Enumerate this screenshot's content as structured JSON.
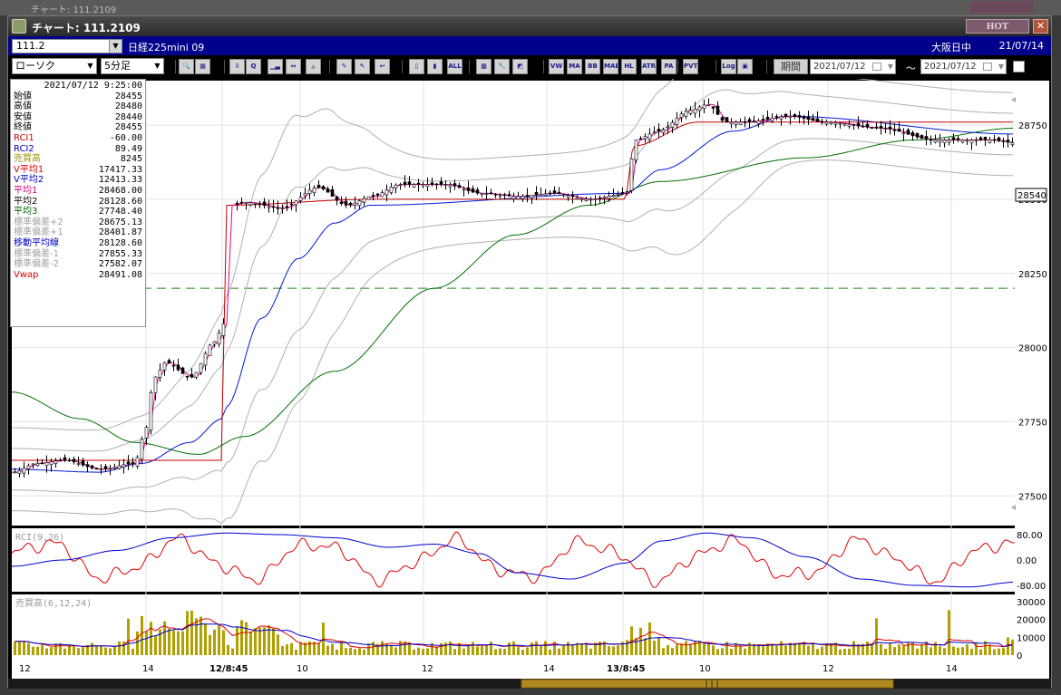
{
  "window": {
    "title": "チャート: 111.2109",
    "hot_label": "HOT",
    "close_label": "✕",
    "background_title": "チャート: 111.2109"
  },
  "infobar": {
    "symbol": "111.2",
    "name": "日経225mini 09",
    "market": "大阪日中",
    "date": "21/07/14"
  },
  "toolbar": {
    "chart_type": "ローソク",
    "interval": "5分足",
    "buttons": [
      {
        "icon": "zoom-icon",
        "label": "🔍"
      },
      {
        "icon": "layout-icon",
        "label": "▦"
      },
      {
        "icon": "download-icon",
        "label": "⇩"
      },
      {
        "icon": "search-chart-icon",
        "label": "Q"
      },
      {
        "icon": "bar-chart-icon",
        "label": "▁▃"
      },
      {
        "icon": "split-icon",
        "label": "↔"
      },
      {
        "icon": "disabled-icon",
        "label": "▲"
      },
      {
        "icon": "pencil-icon",
        "label": "✎"
      },
      {
        "icon": "cursor-icon",
        "label": "↖"
      },
      {
        "icon": "undo-icon",
        "label": "↩"
      },
      {
        "icon": "candle-a-icon",
        "label": "▯"
      },
      {
        "icon": "candle-b-icon",
        "label": "▮"
      },
      {
        "icon": "all-icon",
        "label": "ALL"
      },
      {
        "icon": "grid-icon",
        "label": "▩"
      },
      {
        "icon": "tools-icon",
        "label": "🔧"
      },
      {
        "icon": "color-icon",
        "label": "◩"
      },
      {
        "icon": "vwap-icon",
        "label": "VW"
      },
      {
        "icon": "ma-icon",
        "label": "MA"
      },
      {
        "icon": "bb-icon",
        "label": "BB"
      },
      {
        "icon": "mae-icon",
        "label": "MAE"
      },
      {
        "icon": "hl-icon",
        "label": "HL"
      },
      {
        "icon": "atr-icon",
        "label": "ATR"
      },
      {
        "icon": "para-icon",
        "label": "PA"
      },
      {
        "icon": "pvt-icon",
        "label": "PVT"
      },
      {
        "icon": "log-icon",
        "label": "Log"
      },
      {
        "icon": "panel-icon",
        "label": "▣"
      }
    ],
    "period_label": "期間",
    "date_from": "2021/07/12",
    "date_to": "2021/07/12",
    "tilde": "～"
  },
  "data_panel": {
    "datetime": "2021/07/12  9:25:00",
    "rows": [
      {
        "label": "始値",
        "value": "28455",
        "color": "#000000"
      },
      {
        "label": "高値",
        "value": "28480",
        "color": "#000000"
      },
      {
        "label": "安値",
        "value": "28440",
        "color": "#000000"
      },
      {
        "label": "終値",
        "value": "28455",
        "color": "#000000"
      },
      {
        "label": "RCI1",
        "value": "-60.00",
        "color": "#d40000"
      },
      {
        "label": "RCI2",
        "value": "89.49",
        "color": "#0000c0"
      },
      {
        "label": "売買高",
        "value": "8245",
        "color": "#a09000"
      },
      {
        "label": "V平均1",
        "value": "17417.33",
        "color": "#d40000"
      },
      {
        "label": "V平均2",
        "value": "12413.33",
        "color": "#0000c0"
      },
      {
        "label": "平均1",
        "value": "28468.00",
        "color": "#d4007a"
      },
      {
        "label": "平均2",
        "value": "28128.60",
        "color": "#000000"
      },
      {
        "label": "平均3",
        "value": "27748.40",
        "color": "#006400"
      },
      {
        "label": "標準偏差+2",
        "value": "28675.13",
        "color": "#a0a0a0"
      },
      {
        "label": "標準偏差+1",
        "value": "28401.87",
        "color": "#a0a0a0"
      },
      {
        "label": "移動平均線",
        "value": "28128.60",
        "color": "#0000c0"
      },
      {
        "label": "標準偏差-1",
        "value": "27855.33",
        "color": "#a0a0a0"
      },
      {
        "label": "標準偏差-2",
        "value": "27582.07",
        "color": "#a0a0a0"
      },
      {
        "label": "Vwap",
        "value": "28491.08",
        "color": "#d40000"
      }
    ]
  },
  "price_axis": {
    "ticks": [
      "28750",
      "28500",
      "28250",
      "28000",
      "27750",
      "27500"
    ],
    "current_price": "28540"
  },
  "rci_panel": {
    "label": "RCI(9,26)",
    "ticks": [
      "80.00",
      "0.00",
      "-80.00"
    ]
  },
  "volume_panel": {
    "label": "売買高(6,12,24)",
    "ticks": [
      "30000",
      "20000",
      "10000",
      "0"
    ]
  },
  "time_axis": {
    "labels": [
      "12",
      "14",
      "12/8:45",
      "10",
      "12",
      "14",
      "13/8:45",
      "10",
      "12",
      "14"
    ]
  },
  "colors": {
    "rci1": "#e00000",
    "rci2": "#0000d0",
    "ma_short": "#e0008a",
    "ma_mid": "#0018d8",
    "ma_long": "#007000",
    "bb": "#b0b0b0",
    "volume": "#b0a000",
    "dashed_level": "#1a8a1a"
  },
  "chart_data": {
    "type": "line",
    "title": "",
    "price_series": {
      "x": [
        "12",
        "14",
        "12/8:45",
        "10",
        "12",
        "14",
        "13/8:45",
        "10",
        "12",
        "14"
      ],
      "close": [
        27610,
        27600,
        28490,
        28480,
        28520,
        28520,
        28700,
        28780,
        28770,
        28700
      ]
    },
    "ylim": [
      27400,
      28900
    ]
  }
}
